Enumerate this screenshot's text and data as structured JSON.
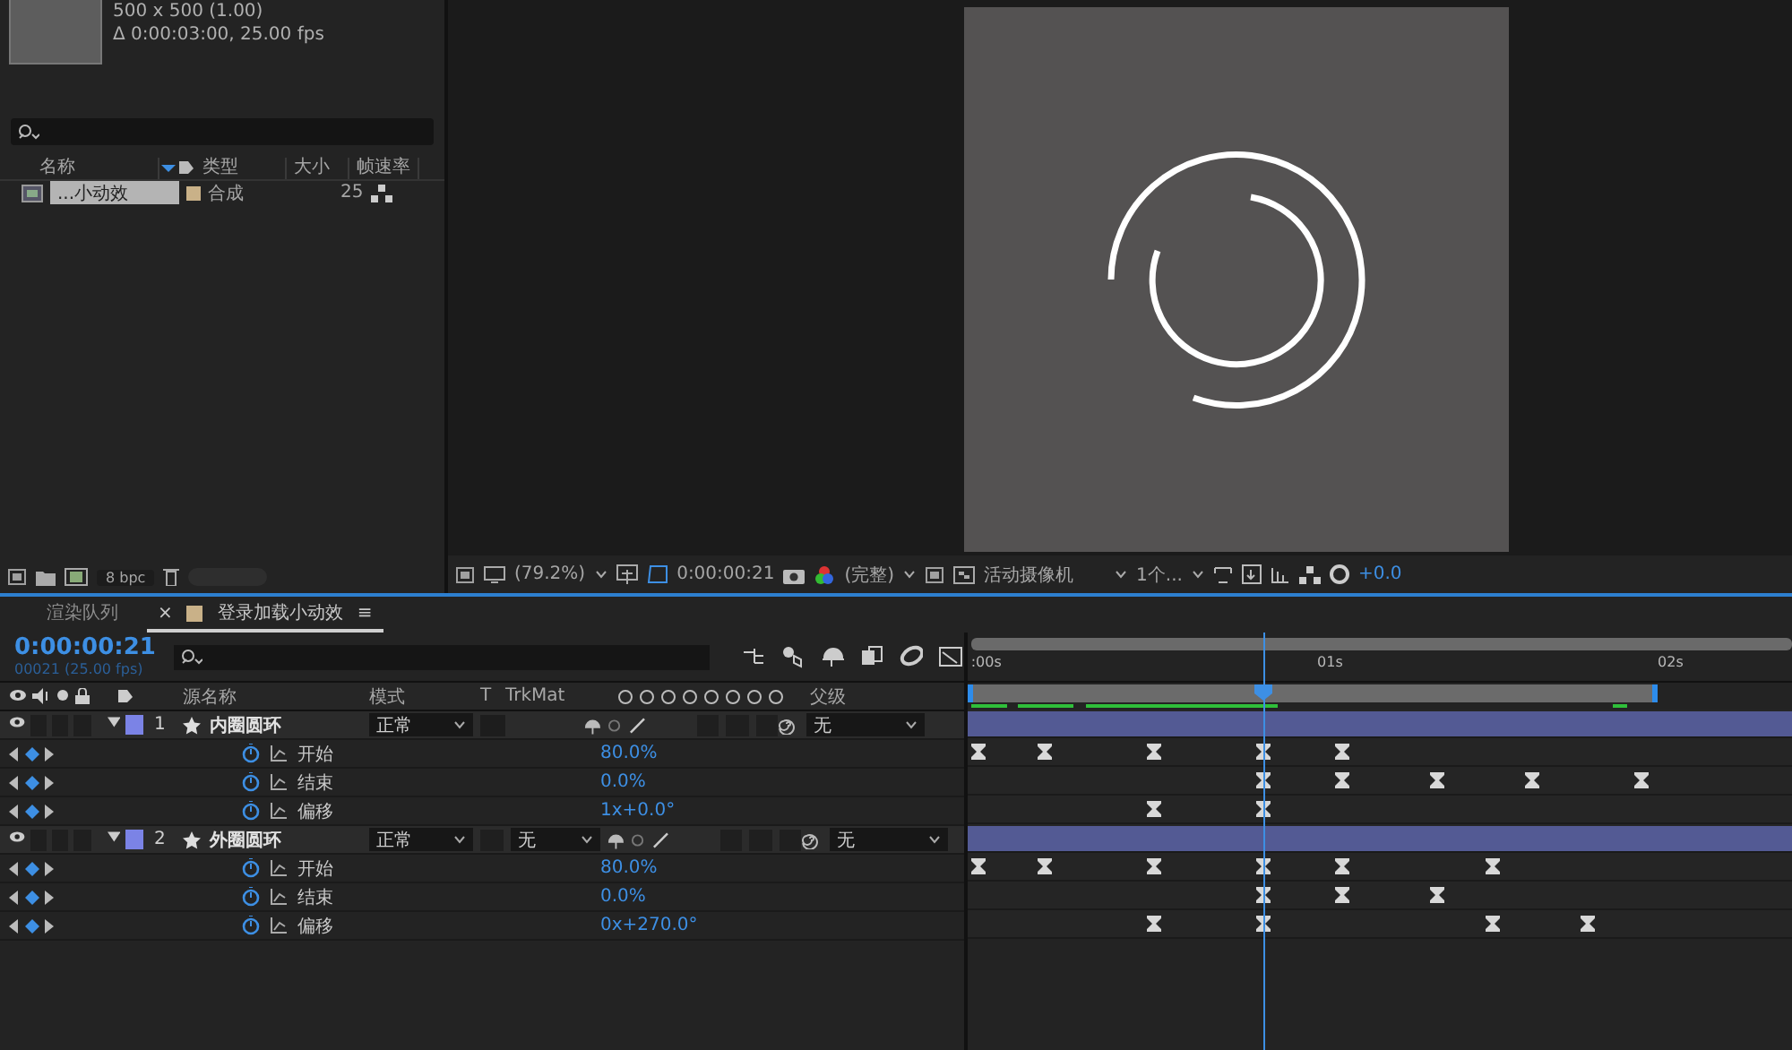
{
  "project": {
    "comp_info": [
      "500 x 500 (1.00)",
      "Δ 0:00:03:00, 25.00 fps"
    ],
    "columns": [
      "名称",
      "类型",
      "大小",
      "帧速率"
    ],
    "items": [
      {
        "name": "...小动效",
        "type": "合成",
        "fps": "25",
        "selected": true
      }
    ],
    "bit_depth": "8 bpc"
  },
  "viewer": {
    "zoom": "(79.2%)",
    "timecode": "0:00:00:21",
    "resolution": "(完整)",
    "camera": "活动摄像机",
    "views": "1个...",
    "exposure": "+0.0"
  },
  "timeline": {
    "tabs": [
      {
        "label": "渲染队列",
        "selected": false
      },
      {
        "label": "登录加载小动效",
        "selected": true,
        "close": "×",
        "menu": "≡"
      }
    ],
    "timecode": "0:00:00:21",
    "frame_info": "00021 (25.00 fps)",
    "columns": [
      "源名称",
      "模式",
      "T",
      "TrkMat",
      "父级"
    ],
    "ruler": [
      {
        "label": ":00s",
        "level": 0.004
      },
      {
        "label": "01s",
        "level": 0.424
      },
      {
        "label": "02s",
        "level": 0.837
      }
    ],
    "playhead": {
      "level": 0.359
    },
    "work_area": {
      "level": 0.837
    },
    "layers": [
      {
        "number": "1",
        "name": "内圈圆环",
        "color": "#7b83e6",
        "visible": true,
        "expanded": true,
        "mode": "正常",
        "parent": "无",
        "properties": [
          {
            "name": "开始",
            "value": "80.0%",
            "keyframes": [
              {
                "level": 0.013
              },
              {
                "level": 0.093
              },
              {
                "level": 0.226
              },
              {
                "level": 0.359
              },
              {
                "level": 0.454
              }
            ]
          },
          {
            "name": "结束",
            "value": "0.0%",
            "keyframes": [
              {
                "level": 0.359
              },
              {
                "level": 0.454
              },
              {
                "level": 0.57
              },
              {
                "level": 0.685
              },
              {
                "level": 0.817
              }
            ]
          },
          {
            "name": "偏移",
            "value": "1x+0.0°",
            "keyframes": [
              {
                "level": 0.226
              },
              {
                "level": 0.359
              }
            ]
          }
        ]
      },
      {
        "number": "2",
        "name": "外圈圆环",
        "color": "#7b83e6",
        "visible": true,
        "expanded": true,
        "mode": "正常",
        "trkmat": "无",
        "parent": "无",
        "properties": [
          {
            "name": "开始",
            "value": "80.0%",
            "keyframes": [
              {
                "level": 0.013
              },
              {
                "level": 0.093
              },
              {
                "level": 0.226
              },
              {
                "level": 0.359
              },
              {
                "level": 0.454
              },
              {
                "level": 0.637
              }
            ]
          },
          {
            "name": "结束",
            "value": "0.0%",
            "keyframes": [
              {
                "level": 0.359
              },
              {
                "level": 0.454
              },
              {
                "level": 0.57
              }
            ]
          },
          {
            "name": "偏移",
            "value": "0x+270.0°",
            "keyframes": [
              {
                "level": 0.226
              },
              {
                "level": 0.359
              },
              {
                "level": 0.637
              },
              {
                "level": 0.752
              }
            ]
          }
        ]
      }
    ]
  }
}
